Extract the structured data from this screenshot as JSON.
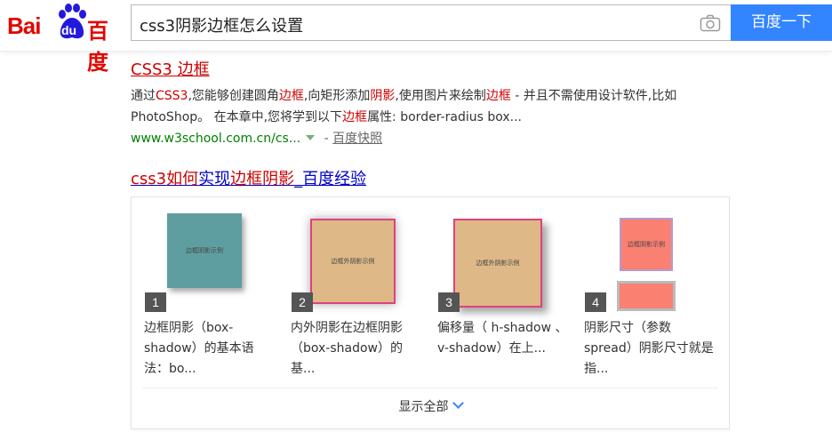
{
  "header": {
    "logo_latin": "Bai",
    "logo_du": "du",
    "logo_cn": "百度",
    "search_query": "css3阴影边框怎么设置",
    "search_button": "百度一下"
  },
  "results": [
    {
      "title_prefix": "CSS3",
      "title_rest": " 边框",
      "abstract_parts": [
        {
          "t": "通过",
          "hl": false
        },
        {
          "t": "CSS3",
          "hl": true
        },
        {
          "t": ",您能够创建圆角",
          "hl": false
        },
        {
          "t": "边框",
          "hl": true
        },
        {
          "t": ",向矩形添加",
          "hl": false
        },
        {
          "t": "阴影",
          "hl": true
        },
        {
          "t": ",使用图片来绘制",
          "hl": false
        },
        {
          "t": "边框",
          "hl": true
        },
        {
          "t": " - 并且不需使用设计软件,比如 PhotoShop。 在本章中,您将学到以下",
          "hl": false
        },
        {
          "t": "边框",
          "hl": true
        },
        {
          "t": "属性: border-radius box...",
          "hl": false
        }
      ],
      "url": "www.w3school.com.cn/cs...",
      "separator": " - ",
      "cache": "百度快照"
    }
  ],
  "result2": {
    "title_a": "css3",
    "title_b": "如何",
    "title_c": "实现",
    "title_d": "边框阴影",
    "title_e": "_百度经验",
    "steps": [
      {
        "num": "1",
        "thumb_text": "边框阴影示例",
        "desc": "边框阴影（box-shadow）的基本语法：bo..."
      },
      {
        "num": "2",
        "thumb_text": "边框外阴影示例",
        "desc": "内外阴影在边框阴影（box-shadow）的基..."
      },
      {
        "num": "3",
        "thumb_text": "边框外阴影示例",
        "desc": "偏移量（ h-shadow 、v-shadow）在上..."
      },
      {
        "num": "4",
        "thumb_text": "边框阴影示例",
        "desc": "阴影尺寸（参数spread）阴影尺寸就是指..."
      }
    ],
    "show_all": "显示全部"
  },
  "colors": {
    "brand_red": "#e10601",
    "brand_blue": "#2319dc",
    "button_blue": "#3385ff",
    "link_red": "#cc0000",
    "link_blue": "#0000cc",
    "url_green": "#008000"
  },
  "icons": {
    "camera": "camera-icon",
    "url_dropdown": "triangle-down-icon",
    "expand": "chevron-down-icon"
  }
}
